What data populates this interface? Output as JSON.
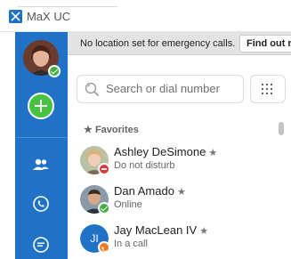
{
  "window": {
    "title": "MaX UC"
  },
  "banner": {
    "message": "No location set for emergency calls.",
    "action_label": "Find out r"
  },
  "search": {
    "placeholder": "Search or dial number"
  },
  "favorites": {
    "header": "Favorites",
    "contacts": [
      {
        "name": "Ashley DeSimone",
        "status": "Do not disturb",
        "presence": "dnd"
      },
      {
        "name": "Dan Amado",
        "status": "Online",
        "presence": "online"
      },
      {
        "name": "Jay MacLean IV",
        "status": "In a call",
        "presence": "in-call",
        "initials": "JI"
      }
    ]
  },
  "icons": {
    "app": "max-uc-logo-icon",
    "add": "plus-icon",
    "contacts": "contacts-icon",
    "calls": "phone-icon",
    "chat": "chat-icon",
    "search": "search-icon",
    "dialpad": "dialpad-icon",
    "favorite": "star-icon"
  },
  "colors": {
    "sidebar": "#1f72c6",
    "accent_add": "#48c241",
    "online": "#3fae3f",
    "dnd": "#e0363a",
    "in_call": "#f07a1f"
  }
}
